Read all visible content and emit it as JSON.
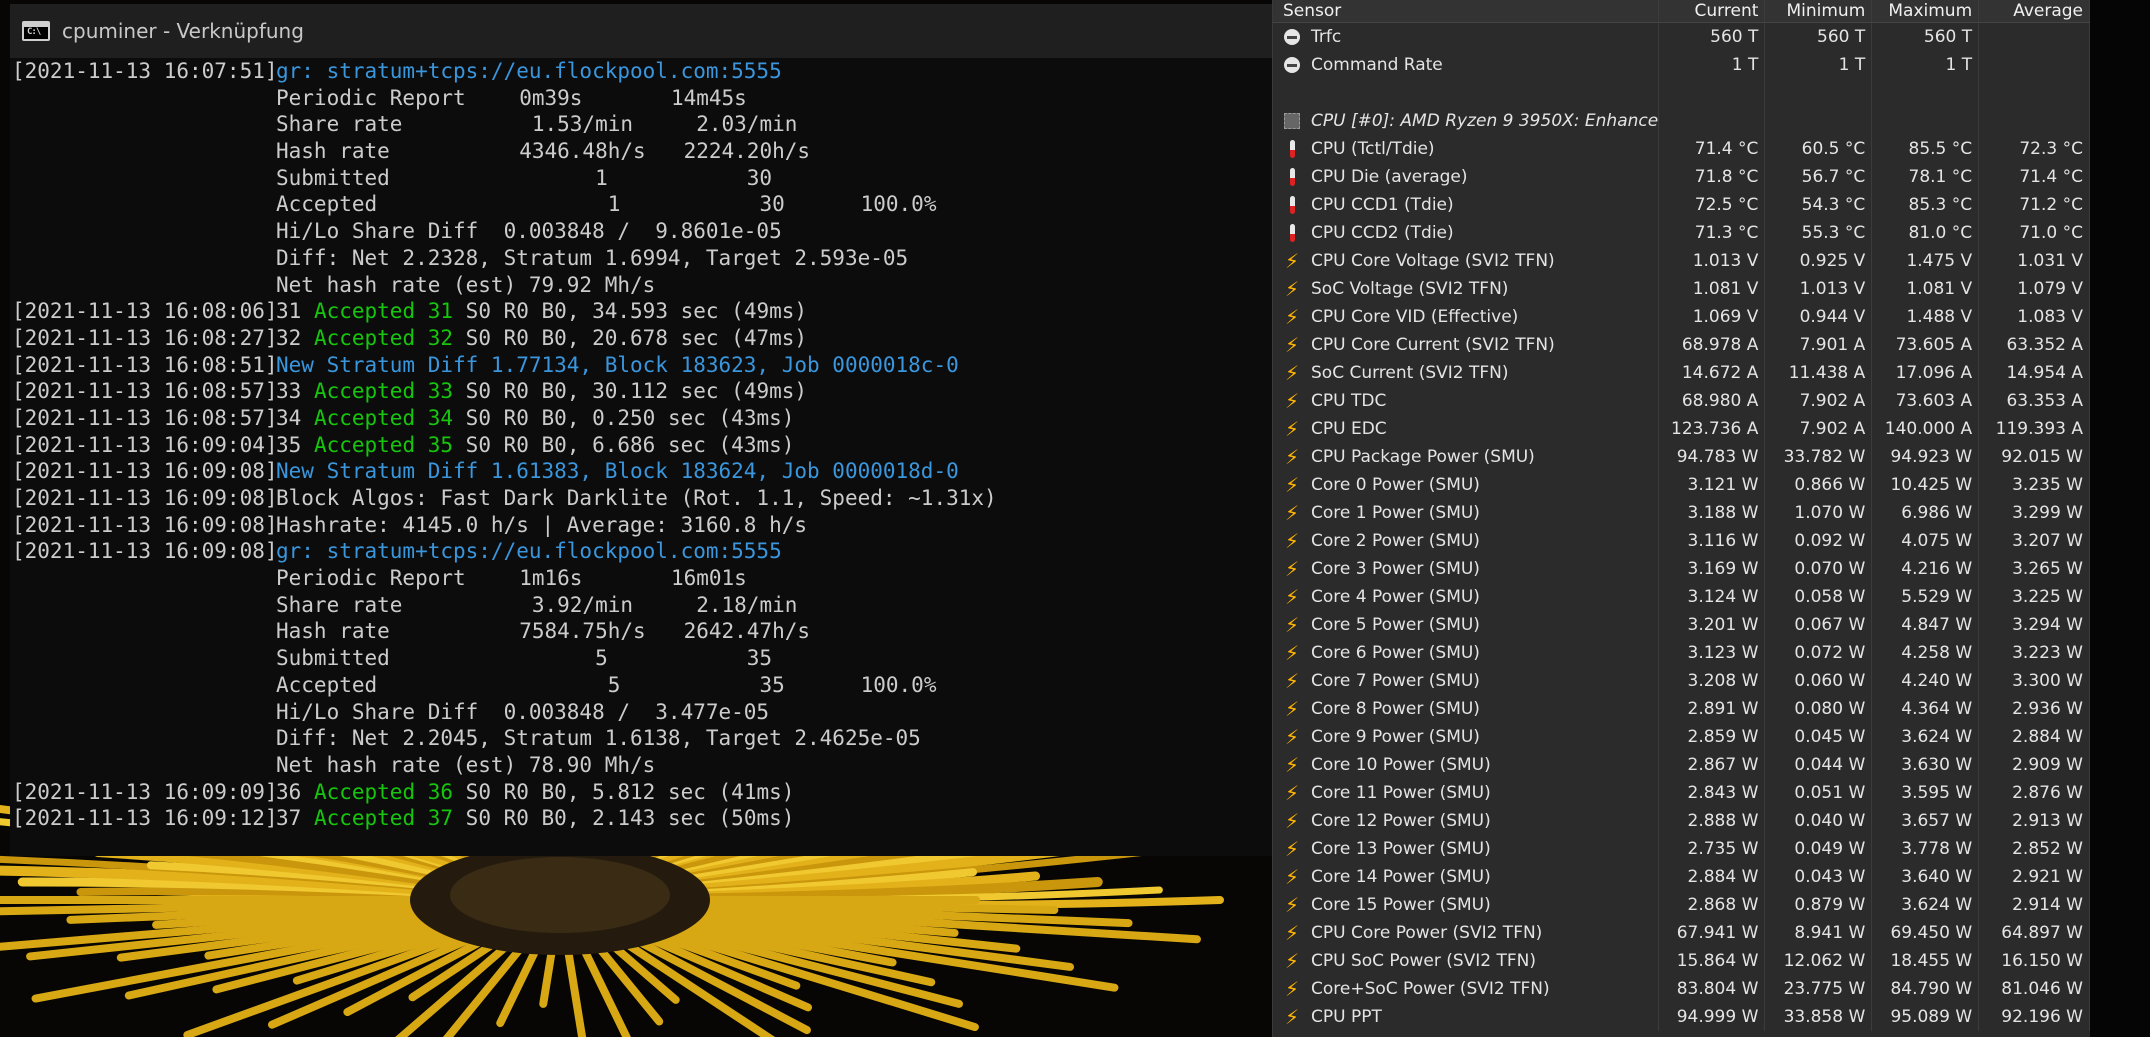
{
  "console": {
    "title": "cpuminer - Verknüpfung",
    "lines": [
      {
        "type": "pool",
        "ts": "[2021-11-13 16:07:51]",
        "text": "gr: stratum+tcps://eu.flockpool.com:5555"
      },
      {
        "type": "report",
        "label": "Periodic Report",
        "a": "     0m39s",
        "b": "       14m45s",
        "c": ""
      },
      {
        "type": "report",
        "label": "Share rate",
        "a": "      1.53/min",
        "b": "     2.03/min",
        "c": ""
      },
      {
        "type": "report",
        "label": "Hash rate",
        "a": "     4346.48h/s",
        "b": "   2224.20h/s",
        "c": ""
      },
      {
        "type": "report",
        "label": "Submitted",
        "a": "           1",
        "b": "           30",
        "c": ""
      },
      {
        "type": "report",
        "label": "Accepted",
        "a": "            1",
        "b": "           30",
        "c": "      100.0%"
      },
      {
        "type": "plain",
        "ts": "",
        "text": "Hi/Lo Share Diff  0.003848 /  9.8601e-05"
      },
      {
        "type": "plain",
        "ts": "",
        "text": "Diff: Net 2.2328, Stratum 1.6994, Target 2.593e-05"
      },
      {
        "type": "plain",
        "ts": "",
        "text": "Net hash rate (est) 79.92 Mh/s"
      },
      {
        "type": "accepted",
        "ts": "[2021-11-13 16:08:06]",
        "n": "31",
        "acc": "Accepted 31",
        "rest": " S0 R0 B0, 34.593 sec (49ms)"
      },
      {
        "type": "accepted",
        "ts": "[2021-11-13 16:08:27]",
        "n": "32",
        "acc": "Accepted 32",
        "rest": " S0 R0 B0, 20.678 sec (47ms)"
      },
      {
        "type": "blue",
        "ts": "[2021-11-13 16:08:51]",
        "text": "New Stratum Diff 1.77134, Block 183623, Job 0000018c-0"
      },
      {
        "type": "accepted",
        "ts": "[2021-11-13 16:08:57]",
        "n": "33",
        "acc": "Accepted 33",
        "rest": " S0 R0 B0, 30.112 sec (49ms)"
      },
      {
        "type": "accepted",
        "ts": "[2021-11-13 16:08:57]",
        "n": "34",
        "acc": "Accepted 34",
        "rest": " S0 R0 B0, 0.250 sec (43ms)"
      },
      {
        "type": "accepted",
        "ts": "[2021-11-13 16:09:04]",
        "n": "35",
        "acc": "Accepted 35",
        "rest": " S0 R0 B0, 6.686 sec (43ms)"
      },
      {
        "type": "blue",
        "ts": "[2021-11-13 16:09:08]",
        "text": "New Stratum Diff 1.61383, Block 183624, Job 0000018d-0"
      },
      {
        "type": "plain",
        "ts": "[2021-11-13 16:09:08]",
        "text": "Block Algos: Fast Dark Darklite (Rot. 1.1, Speed: ~1.31x)"
      },
      {
        "type": "plain",
        "ts": "[2021-11-13 16:09:08]",
        "text": "Hashrate: 4145.0 h/s | Average: 3160.8 h/s"
      },
      {
        "type": "pool",
        "ts": "[2021-11-13 16:09:08]",
        "text": "gr: stratum+tcps://eu.flockpool.com:5555"
      },
      {
        "type": "report",
        "label": "Periodic Report",
        "a": "     1m16s",
        "b": "       16m01s",
        "c": ""
      },
      {
        "type": "report",
        "label": "Share rate",
        "a": "      3.92/min",
        "b": "     2.18/min",
        "c": ""
      },
      {
        "type": "report",
        "label": "Hash rate",
        "a": "     7584.75h/s",
        "b": "   2642.47h/s",
        "c": ""
      },
      {
        "type": "report",
        "label": "Submitted",
        "a": "           5",
        "b": "           35",
        "c": ""
      },
      {
        "type": "report",
        "label": "Accepted",
        "a": "            5",
        "b": "           35",
        "c": "      100.0%"
      },
      {
        "type": "plain",
        "ts": "",
        "text": "Hi/Lo Share Diff  0.003848 /  3.477e-05"
      },
      {
        "type": "plain",
        "ts": "",
        "text": "Diff: Net 2.2045, Stratum 1.6138, Target 2.4625e-05"
      },
      {
        "type": "plain",
        "ts": "",
        "text": "Net hash rate (est) 78.90 Mh/s"
      },
      {
        "type": "accepted",
        "ts": "[2021-11-13 16:09:09]",
        "n": "36",
        "acc": "Accepted 36",
        "rest": " S0 R0 B0, 5.812 sec (41ms)"
      },
      {
        "type": "accepted",
        "ts": "[2021-11-13 16:09:12]",
        "n": "37",
        "acc": "Accepted 37",
        "rest": " S0 R0 B0, 2.143 sec (50ms)"
      }
    ]
  },
  "hwinfo": {
    "columns": [
      "Sensor",
      "Current",
      "Minimum",
      "Maximum",
      "Average"
    ],
    "rows": [
      {
        "icon": "clock",
        "name": "Trfc",
        "cur": "560 T",
        "min": "560 T",
        "max": "560 T",
        "avg": ""
      },
      {
        "icon": "clock",
        "name": "Command Rate",
        "cur": "1 T",
        "min": "1 T",
        "max": "1 T",
        "avg": ""
      },
      {
        "icon": "none",
        "name": "",
        "cur": "",
        "min": "",
        "max": "",
        "avg": ""
      },
      {
        "icon": "chip",
        "name": "CPU [#0]: AMD Ryzen 9 3950X: Enhanced",
        "cur": "",
        "min": "",
        "max": "",
        "avg": "",
        "group": true
      },
      {
        "icon": "therm",
        "name": "CPU (Tctl/Tdie)",
        "cur": "71.4 °C",
        "min": "60.5 °C",
        "max": "85.5 °C",
        "avg": "72.3 °C"
      },
      {
        "icon": "therm",
        "name": "CPU Die (average)",
        "cur": "71.8 °C",
        "min": "56.7 °C",
        "max": "78.1 °C",
        "avg": "71.4 °C"
      },
      {
        "icon": "therm",
        "name": "CPU CCD1 (Tdie)",
        "cur": "72.5 °C",
        "min": "54.3 °C",
        "max": "85.3 °C",
        "avg": "71.2 °C"
      },
      {
        "icon": "therm",
        "name": "CPU CCD2 (Tdie)",
        "cur": "71.3 °C",
        "min": "55.3 °C",
        "max": "81.0 °C",
        "avg": "71.0 °C"
      },
      {
        "icon": "bolt",
        "name": "CPU Core Voltage (SVI2 TFN)",
        "cur": "1.013 V",
        "min": "0.925 V",
        "max": "1.475 V",
        "avg": "1.031 V"
      },
      {
        "icon": "bolt",
        "name": "SoC Voltage (SVI2 TFN)",
        "cur": "1.081 V",
        "min": "1.013 V",
        "max": "1.081 V",
        "avg": "1.079 V"
      },
      {
        "icon": "bolt",
        "name": "CPU Core VID (Effective)",
        "cur": "1.069 V",
        "min": "0.944 V",
        "max": "1.488 V",
        "avg": "1.083 V"
      },
      {
        "icon": "bolt",
        "name": "CPU Core Current (SVI2 TFN)",
        "cur": "68.978 A",
        "min": "7.901 A",
        "max": "73.605 A",
        "avg": "63.352 A"
      },
      {
        "icon": "bolt",
        "name": "SoC Current (SVI2 TFN)",
        "cur": "14.672 A",
        "min": "11.438 A",
        "max": "17.096 A",
        "avg": "14.954 A"
      },
      {
        "icon": "bolt",
        "name": "CPU TDC",
        "cur": "68.980 A",
        "min": "7.902 A",
        "max": "73.603 A",
        "avg": "63.353 A"
      },
      {
        "icon": "bolt",
        "name": "CPU EDC",
        "cur": "123.736 A",
        "min": "7.902 A",
        "max": "140.000 A",
        "avg": "119.393 A"
      },
      {
        "icon": "bolt",
        "name": "CPU Package Power (SMU)",
        "cur": "94.783 W",
        "min": "33.782 W",
        "max": "94.923 W",
        "avg": "92.015 W"
      },
      {
        "icon": "bolt",
        "name": "Core 0 Power (SMU)",
        "cur": "3.121 W",
        "min": "0.866 W",
        "max": "10.425 W",
        "avg": "3.235 W"
      },
      {
        "icon": "bolt",
        "name": "Core 1 Power (SMU)",
        "cur": "3.188 W",
        "min": "1.070 W",
        "max": "6.986 W",
        "avg": "3.299 W"
      },
      {
        "icon": "bolt",
        "name": "Core 2 Power (SMU)",
        "cur": "3.116 W",
        "min": "0.092 W",
        "max": "4.075 W",
        "avg": "3.207 W"
      },
      {
        "icon": "bolt",
        "name": "Core 3 Power (SMU)",
        "cur": "3.169 W",
        "min": "0.070 W",
        "max": "4.216 W",
        "avg": "3.265 W"
      },
      {
        "icon": "bolt",
        "name": "Core 4 Power (SMU)",
        "cur": "3.124 W",
        "min": "0.058 W",
        "max": "5.529 W",
        "avg": "3.225 W"
      },
      {
        "icon": "bolt",
        "name": "Core 5 Power (SMU)",
        "cur": "3.201 W",
        "min": "0.067 W",
        "max": "4.847 W",
        "avg": "3.294 W"
      },
      {
        "icon": "bolt",
        "name": "Core 6 Power (SMU)",
        "cur": "3.123 W",
        "min": "0.072 W",
        "max": "4.258 W",
        "avg": "3.223 W"
      },
      {
        "icon": "bolt",
        "name": "Core 7 Power (SMU)",
        "cur": "3.208 W",
        "min": "0.060 W",
        "max": "4.240 W",
        "avg": "3.300 W"
      },
      {
        "icon": "bolt",
        "name": "Core 8 Power (SMU)",
        "cur": "2.891 W",
        "min": "0.080 W",
        "max": "4.364 W",
        "avg": "2.936 W"
      },
      {
        "icon": "bolt",
        "name": "Core 9 Power (SMU)",
        "cur": "2.859 W",
        "min": "0.045 W",
        "max": "3.624 W",
        "avg": "2.884 W"
      },
      {
        "icon": "bolt",
        "name": "Core 10 Power (SMU)",
        "cur": "2.867 W",
        "min": "0.044 W",
        "max": "3.630 W",
        "avg": "2.909 W"
      },
      {
        "icon": "bolt",
        "name": "Core 11 Power (SMU)",
        "cur": "2.843 W",
        "min": "0.051 W",
        "max": "3.595 W",
        "avg": "2.876 W"
      },
      {
        "icon": "bolt",
        "name": "Core 12 Power (SMU)",
        "cur": "2.888 W",
        "min": "0.040 W",
        "max": "3.657 W",
        "avg": "2.913 W"
      },
      {
        "icon": "bolt",
        "name": "Core 13 Power (SMU)",
        "cur": "2.735 W",
        "min": "0.049 W",
        "max": "3.778 W",
        "avg": "2.852 W"
      },
      {
        "icon": "bolt",
        "name": "Core 14 Power (SMU)",
        "cur": "2.884 W",
        "min": "0.043 W",
        "max": "3.640 W",
        "avg": "2.921 W"
      },
      {
        "icon": "bolt",
        "name": "Core 15 Power (SMU)",
        "cur": "2.868 W",
        "min": "0.879 W",
        "max": "3.624 W",
        "avg": "2.914 W"
      },
      {
        "icon": "bolt",
        "name": "CPU Core Power (SVI2 TFN)",
        "cur": "67.941 W",
        "min": "8.941 W",
        "max": "69.450 W",
        "avg": "64.897 W"
      },
      {
        "icon": "bolt",
        "name": "CPU SoC Power (SVI2 TFN)",
        "cur": "15.864 W",
        "min": "12.062 W",
        "max": "18.455 W",
        "avg": "16.150 W"
      },
      {
        "icon": "bolt",
        "name": "Core+SoC Power (SVI2 TFN)",
        "cur": "83.804 W",
        "min": "23.775 W",
        "max": "84.790 W",
        "avg": "81.046 W"
      },
      {
        "icon": "bolt",
        "name": "CPU PPT",
        "cur": "94.999 W",
        "min": "33.858 W",
        "max": "95.089 W",
        "avg": "92.196 W"
      }
    ]
  },
  "colors": {
    "console_bg": "#0c0c0c",
    "console_text": "#cccccc",
    "link_blue": "#3a96dd",
    "accepted_green": "#16c60c",
    "table_bg": "#2b2b2b",
    "bolt_orange": "#ffb400"
  }
}
